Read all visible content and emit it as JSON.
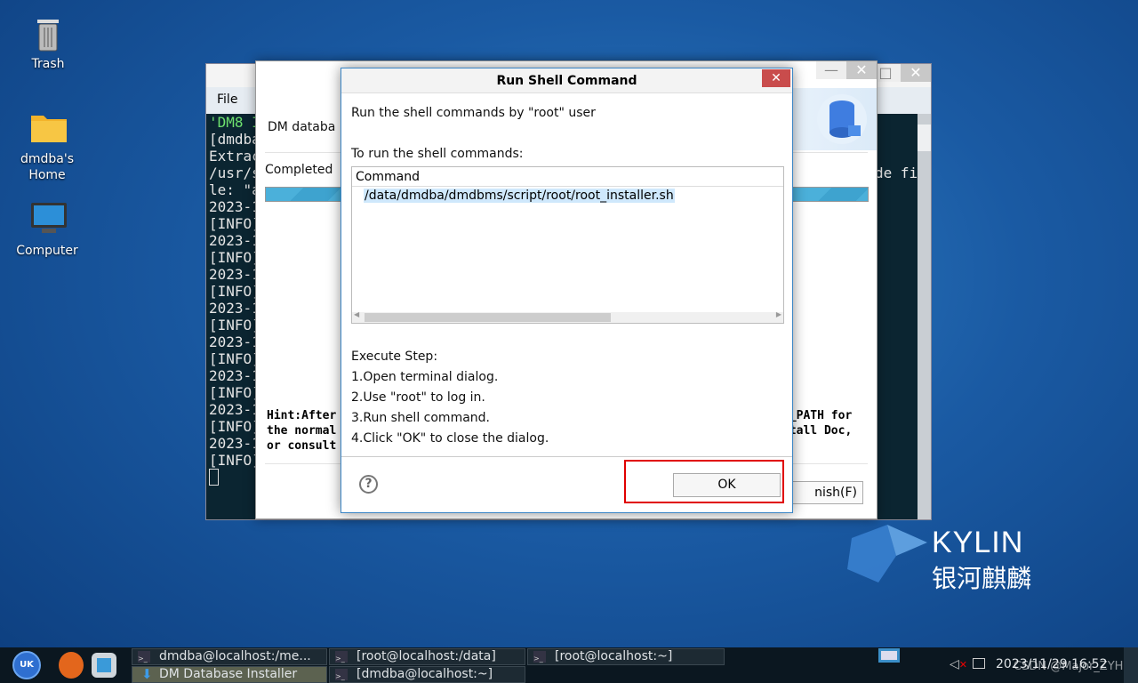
{
  "desktop": {
    "icons": [
      {
        "label": "Trash",
        "icon": "trash-icon"
      },
      {
        "label": "dmdba's\nHome",
        "icon": "home-folder-icon"
      },
      {
        "label": "Computer",
        "icon": "computer-icon"
      }
    ],
    "brand": {
      "name": "KYLIN",
      "sub": "银河麒麟",
      "watermark": "CSDN @Major_ZYH"
    }
  },
  "terminal": {
    "menu": [
      "File"
    ],
    "lines": [
      "'DM8 I",
      "[dmdba",
      "Extrac",
      "/usr/s",
      "le: \"a",
      "2023-1",
      "[INFO]",
      "2023-1",
      "[INFO]",
      "2023-1",
      "[INFO]",
      "2023-1",
      "[INFO]",
      "2023-1",
      "[INFO]",
      "2023-1",
      "[INFO]",
      "2023-1",
      "[INFO]",
      "2023-1",
      "[INFO]"
    ],
    "right_fragment": "de fi"
  },
  "installer": {
    "header_text": "DM databa",
    "status": "Completed",
    "progress": 100,
    "hint_left": "Hint:After\nthe normal\nor consult",
    "hint_right": "Y_PATH for\nstall Doc,",
    "finish_label": "nish(F)"
  },
  "dialog": {
    "title": "Run Shell Command",
    "line1": "Run the shell commands by \"root\" user",
    "line2": "To run the shell commands:",
    "table": {
      "header": "Command",
      "rows": [
        "/data/dmdba/dmdbms/script/root/root_installer.sh"
      ]
    },
    "steps_title": "Execute Step:",
    "steps": [
      "1.Open terminal dialog.",
      "2.Use \"root\" to log in.",
      "3.Run shell command.",
      "4.Click \"OK\" to close the dialog."
    ],
    "ok_label": "OK",
    "highlight_color": "#e00000"
  },
  "taskbar": {
    "tasks": [
      {
        "label": "dmdba@localhost:/me..."
      },
      {
        "label": "[root@localhost:/data]"
      },
      {
        "label": "[root@localhost:~]"
      },
      {
        "label": "DM Database Installer",
        "active": true
      },
      {
        "label": "[dmdba@localhost:~]"
      }
    ],
    "clock": "2023/11/29 16:52"
  }
}
